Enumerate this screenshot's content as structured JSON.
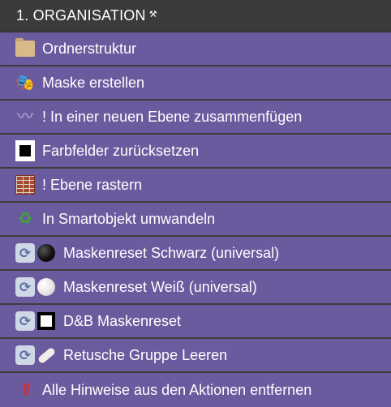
{
  "panel": {
    "title": "1. ORGANISATION",
    "pin_glyph": "⚒"
  },
  "actions": [
    {
      "label": "Ordnerstruktur",
      "icons": [
        "folder-icon"
      ]
    },
    {
      "label": "Maske erstellen",
      "icons": [
        "theater-masks-icon"
      ]
    },
    {
      "label": "! In einer neuen Ebene zusammenfügen",
      "icons": [
        "wavy-dash-icon"
      ]
    },
    {
      "label": "Farbfelder zurücksetzen",
      "icons": [
        "black-square-icon"
      ]
    },
    {
      "label": "! Ebene rastern",
      "icons": [
        "brick-icon"
      ]
    },
    {
      "label": "In Smartobjekt umwandeln",
      "icons": [
        "recycle-icon"
      ]
    },
    {
      "label": "Maskenreset Schwarz (universal)",
      "icons": [
        "repeat-icon",
        "black-circle-icon"
      ]
    },
    {
      "label": "Maskenreset Weiß (universal)",
      "icons": [
        "repeat-icon",
        "white-circle-icon"
      ]
    },
    {
      "label": "D&B Maskenreset",
      "icons": [
        "repeat-icon",
        "white-square-icon"
      ]
    },
    {
      "label": "Retusche Gruppe Leeren",
      "icons": [
        "repeat-icon",
        "bandage-icon"
      ]
    },
    {
      "label": "Alle Hinweise aus den Aktionen entfernen",
      "icons": [
        "double-exclamation-icon"
      ]
    }
  ],
  "colors": {
    "row_background": "#6a5b9e",
    "header_background": "#3b3b3b",
    "divider": "#3c3c3c",
    "text": "#ffffff"
  }
}
